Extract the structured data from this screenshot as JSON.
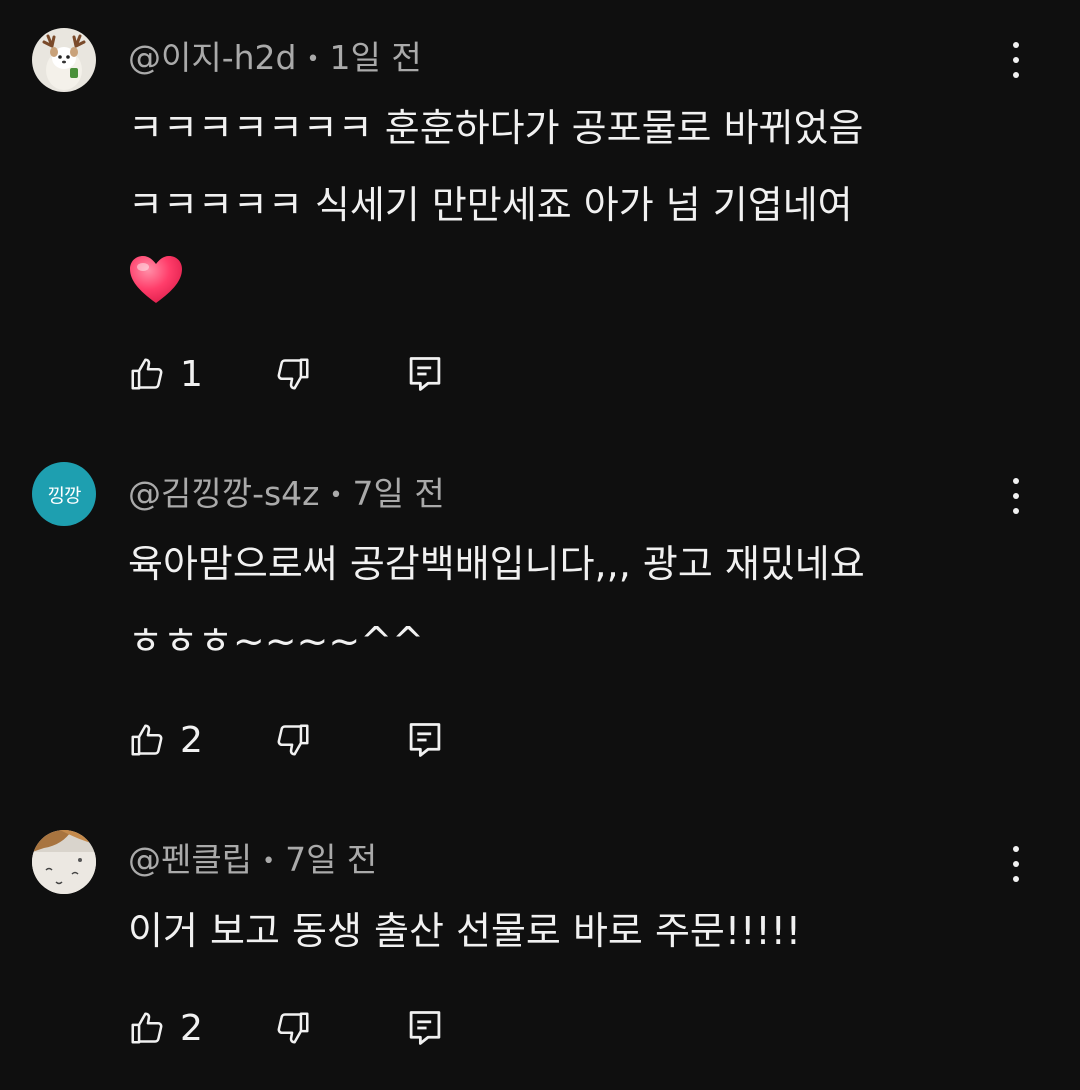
{
  "comments": [
    {
      "author": "@이지-h2d",
      "time": "1일 전",
      "line1": "ㅋㅋㅋㅋㅋㅋㅋ 훈훈하다가 공포물로 바뀌었음",
      "line2": "ㅋㅋㅋㅋㅋ 식세기 만만세죠 아가 넘 기엽네여",
      "emoji": "heart-emoji",
      "likes": "1"
    },
    {
      "author": "@김낑깡-s4z",
      "time": "7일 전",
      "avatar_text": "낑깡",
      "line1": "육아맘으로써 공감백배입니다,,, 광고 재밌네요",
      "line2": "ㅎㅎㅎ~~~~^^",
      "likes": "2"
    },
    {
      "author": "@펜클립",
      "time": "7일 전",
      "line1": "이거 보고 동생 출산 선물로 바로 주문!!!!!",
      "likes": "2"
    }
  ],
  "colors": {
    "background": "#0f0f0f",
    "text": "#f1f1f1",
    "meta": "#aaaaaa",
    "avatar_teal": "#1e9fb0"
  },
  "icons": [
    "thumbs-up-icon",
    "thumbs-down-icon",
    "reply-icon",
    "more-vert-icon"
  ]
}
